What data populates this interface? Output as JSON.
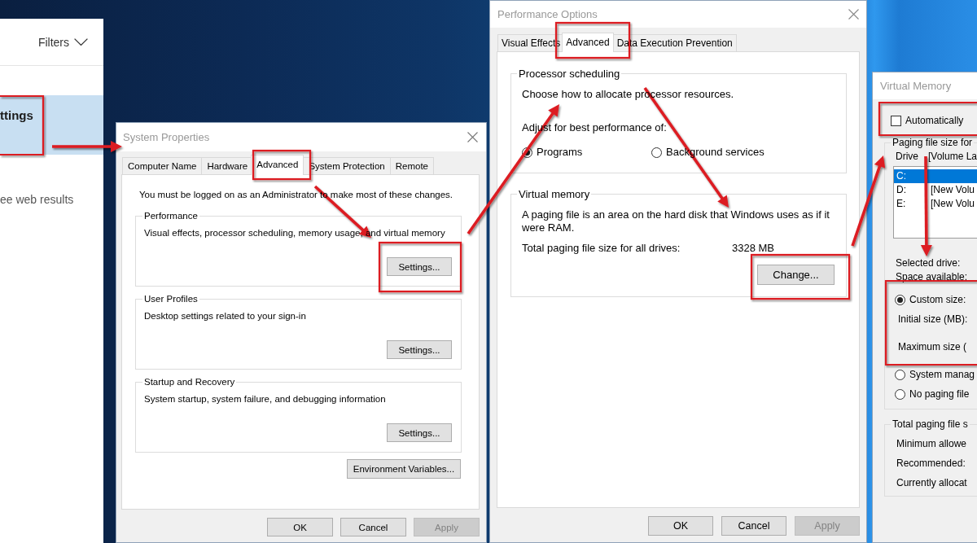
{
  "search_panel": {
    "filters": "Filters",
    "results": [
      {
        "title": "ttings",
        "selected": true
      }
    ],
    "web_results": "ee web results"
  },
  "system_properties": {
    "title": "System Properties",
    "tabs": [
      {
        "label": "Computer Name",
        "selected": false
      },
      {
        "label": "Hardware",
        "selected": false
      },
      {
        "label": "Advanced",
        "selected": true
      },
      {
        "label": "System Protection",
        "selected": false
      },
      {
        "label": "Remote",
        "selected": false
      }
    ],
    "notice": "You must be logged on as an Administrator to make most of these changes.",
    "groups": [
      {
        "title": "Performance",
        "description": "Visual effects, processor scheduling, memory usage, and virtual memory",
        "button": "Settings..."
      },
      {
        "title": "User Profiles",
        "description": "Desktop settings related to your sign-in",
        "button": "Settings..."
      },
      {
        "title": "Startup and Recovery",
        "description": "System startup, system failure, and debugging information",
        "button": "Settings..."
      }
    ],
    "extra_button": "Environment Variables...",
    "buttons": [
      {
        "label": "OK",
        "disabled": false
      },
      {
        "label": "Cancel",
        "disabled": false
      },
      {
        "label": "Apply",
        "disabled": true
      }
    ]
  },
  "performance_options": {
    "title": "Performance Options",
    "tabs": [
      {
        "label": "Visual Effects",
        "selected": false
      },
      {
        "label": "Advanced",
        "selected": true
      },
      {
        "label": "Data Execution Prevention",
        "selected": false
      }
    ],
    "processor_scheduling": {
      "title": "Processor scheduling",
      "intro": "Choose how to allocate processor resources.",
      "prompt": "Adjust for best performance of:",
      "options": [
        {
          "label": "Programs",
          "selected": true
        },
        {
          "label": "Background services",
          "selected": false
        }
      ]
    },
    "virtual_memory": {
      "title": "Virtual memory",
      "description": "A paging file is an area on the hard disk that Windows uses as if it were RAM.",
      "total_label": "Total paging file size for all drives:",
      "total_value": "3328 MB",
      "button": "Change..."
    },
    "buttons": [
      {
        "label": "OK",
        "disabled": false
      },
      {
        "label": "Cancel",
        "disabled": false
      },
      {
        "label": "Apply",
        "disabled": true
      }
    ]
  },
  "virtual_memory": {
    "title": "Virtual Memory",
    "auto_manage": {
      "label": "Automatically",
      "checked": false
    },
    "paging_group_title": "Paging file size for",
    "list_columns": [
      "Drive",
      "[Volume La"
    ],
    "drives": [
      {
        "drive": "C:",
        "selected": true
      },
      {
        "drive": "D:",
        "volume": "[New Volu",
        "selected": false
      },
      {
        "drive": "E:",
        "volume": "[New Volu",
        "selected": false
      }
    ],
    "selected_drive_label": "Selected drive:",
    "space_available_label": "Space available:",
    "size_options": [
      {
        "kind": "radio",
        "label": "Custom size:",
        "selected": true
      },
      {
        "kind": "field",
        "label": "Initial size (MB):"
      },
      {
        "kind": "field",
        "label": "Maximum size ("
      },
      {
        "kind": "radio",
        "label": "System manag",
        "selected": false
      },
      {
        "kind": "radio",
        "label": "No paging file",
        "selected": false
      }
    ],
    "totals_title": "Total paging file s",
    "totals_rows": [
      "Minimum allowe",
      "Recommended:",
      "Currently allocat"
    ]
  }
}
